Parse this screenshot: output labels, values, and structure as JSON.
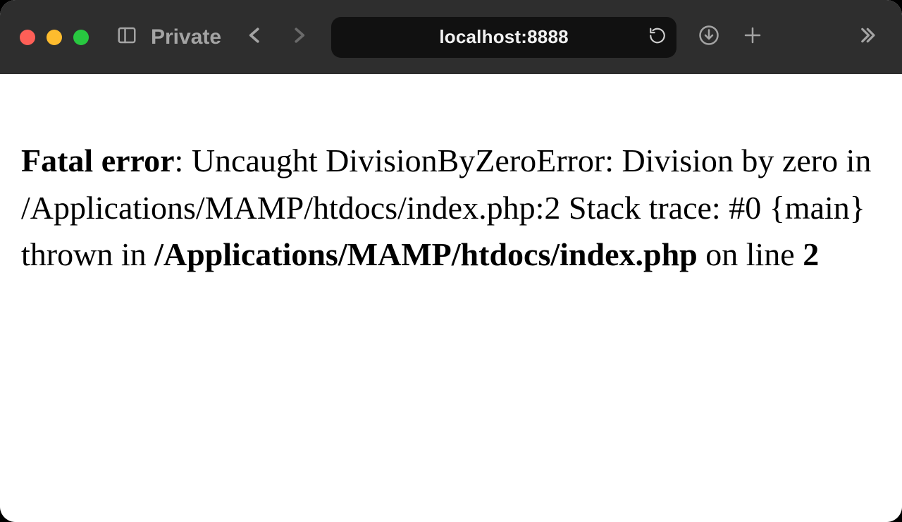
{
  "toolbar": {
    "private_label": "Private",
    "address": "localhost:8888"
  },
  "error": {
    "label": "Fatal error",
    "sep1": ": ",
    "message": "Uncaught DivisionByZeroError: Division by zero in /Applications/MAMP/htdocs/index.php:2 Stack trace: #0 {main} thrown in ",
    "file": "/Applications/MAMP/htdocs/index.php",
    "on_line_prefix": " on line ",
    "line_number": "2"
  }
}
